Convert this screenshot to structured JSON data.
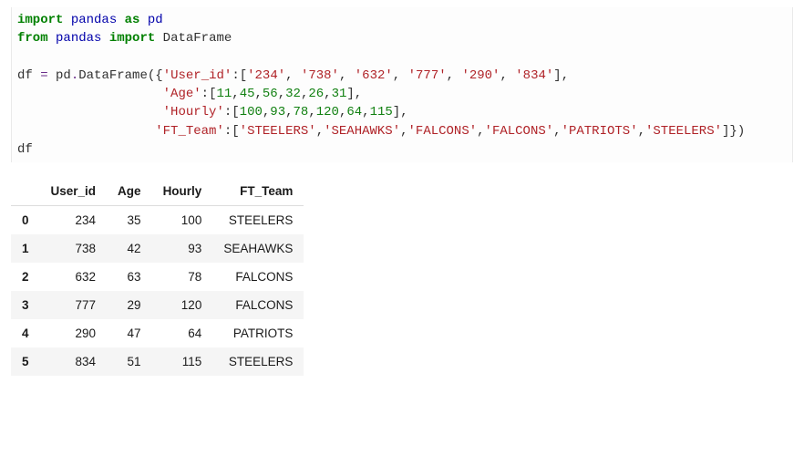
{
  "code": {
    "kw_import1": "import",
    "pandas1": "pandas",
    "kw_as": "as",
    "pd1": "pd",
    "kw_from": "from",
    "pandas2": "pandas",
    "kw_import2": "import",
    "dataframe_name": "DataFrame",
    "df_var": "df",
    "eq": "=",
    "pd2": "pd",
    "dot": ".",
    "dataframe_call": "DataFrame",
    "open_paren": "(",
    "open_brace": "{",
    "key_user_id": "'User_id'",
    "colon": ":",
    "open_bracket": "[",
    "uid0": "'234'",
    "uid1": "'738'",
    "uid2": "'632'",
    "uid3": "'777'",
    "uid4": "'290'",
    "uid5": "'834'",
    "close_bracket": "]",
    "comma": ",",
    "key_age": "'Age'",
    "age0": "11",
    "age1": "45",
    "age2": "56",
    "age3": "32",
    "age4": "26",
    "age5": "31",
    "key_hourly": "'Hourly'",
    "h0": "100",
    "h1": "93",
    "h2": "78",
    "h3": "120",
    "h4": "64",
    "h5": "115",
    "key_team": "'FT_Team'",
    "t0": "'STEELERS'",
    "t1": "'SEAHAWKS'",
    "t2": "'FALCONS'",
    "t3": "'FALCONS'",
    "t4": "'PATRIOTS'",
    "t5": "'STEELERS'",
    "close_brace": "}",
    "close_paren": ")",
    "df_eval": "df"
  },
  "table": {
    "columns": [
      "User_id",
      "Age",
      "Hourly",
      "FT_Team"
    ],
    "rows": [
      {
        "idx": "0",
        "User_id": "234",
        "Age": "35",
        "Hourly": "100",
        "FT_Team": "STEELERS"
      },
      {
        "idx": "1",
        "User_id": "738",
        "Age": "42",
        "Hourly": "93",
        "FT_Team": "SEAHAWKS"
      },
      {
        "idx": "2",
        "User_id": "632",
        "Age": "63",
        "Hourly": "78",
        "FT_Team": "FALCONS"
      },
      {
        "idx": "3",
        "User_id": "777",
        "Age": "29",
        "Hourly": "120",
        "FT_Team": "FALCONS"
      },
      {
        "idx": "4",
        "User_id": "290",
        "Age": "47",
        "Hourly": "64",
        "FT_Team": "PATRIOTS"
      },
      {
        "idx": "5",
        "User_id": "834",
        "Age": "51",
        "Hourly": "115",
        "FT_Team": "STEELERS"
      }
    ]
  }
}
